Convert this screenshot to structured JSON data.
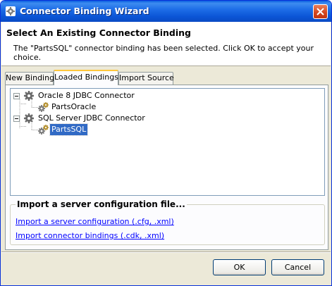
{
  "window": {
    "title": "Connector Binding Wizard",
    "icon": "wizard-app-icon"
  },
  "header": {
    "title": "Select An Existing Connector Binding",
    "message": "The \"PartsSQL\" connector binding has been selected. Click OK to accept your choice."
  },
  "tabs": [
    {
      "label": "New Binding",
      "active": false
    },
    {
      "label": "Loaded Bindings",
      "active": true
    },
    {
      "label": "Import Source",
      "active": false
    }
  ],
  "tree": {
    "nodes": [
      {
        "label": "Oracle 8 JDBC Connector",
        "expanded": true,
        "icon": "connector-gear-icon",
        "children": [
          {
            "label": "PartsOracle",
            "icon": "binding-gear-icon",
            "selected": false
          }
        ]
      },
      {
        "label": "SQL Server JDBC Connector",
        "expanded": true,
        "icon": "connector-gear-icon",
        "children": [
          {
            "label": "PartsSQL",
            "icon": "binding-gear-icon",
            "selected": true
          }
        ]
      }
    ]
  },
  "import_group": {
    "title": "Import a server configuration file...",
    "links": [
      "Import a server configuration (.cfg, .xml)",
      "Import connector bindings (.cdk, .xml)"
    ]
  },
  "buttons": {
    "ok": "OK",
    "cancel": "Cancel"
  },
  "colors": {
    "title_bar": "#0b55d6",
    "selection": "#316ac5",
    "link": "#0000ff",
    "tab_highlight": "#ffc73c"
  }
}
